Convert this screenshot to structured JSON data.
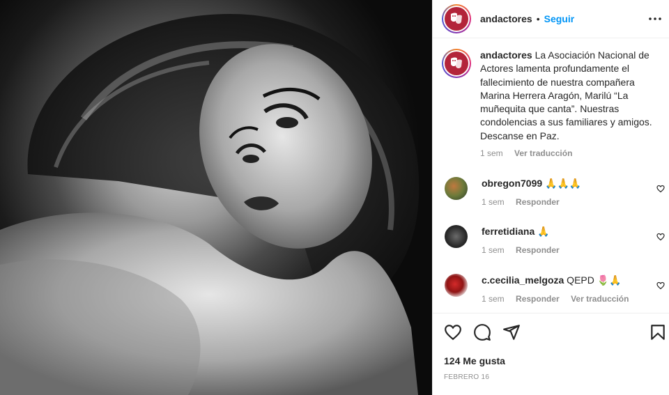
{
  "post": {
    "username": "andactores",
    "follow_label": "Seguir",
    "separator": "•",
    "caption_user": "andactores",
    "caption_text": " La Asociación Nacional de Actores lamenta profundamente el fallecimiento de nuestra compañera Marina Herrera Aragón, Marilú “La muñequita que canta”. Nuestras condolencias a sus familiares y amigos. Descanse en Paz.",
    "caption_time": "1 sem",
    "caption_translate": "Ver traducción",
    "likes": "124 Me gusta",
    "date": "FEBRERO 16"
  },
  "comments": [
    {
      "user": "obregon7099",
      "text": " 🙏🙏🙏",
      "time": "1 sem",
      "reply": "Responder",
      "translate": ""
    },
    {
      "user": "ferretidiana",
      "text": " 🙏",
      "time": "1 sem",
      "reply": "Responder",
      "translate": ""
    },
    {
      "user": "c.cecilia_melgoza",
      "text": " QEPD 🌷🙏",
      "time": "1 sem",
      "reply": "Responder",
      "translate": "Ver traducción"
    }
  ],
  "icons": {
    "more": "more-horizontal-icon",
    "like": "heart-icon",
    "comment": "comment-icon",
    "share": "share-icon",
    "save": "bookmark-icon"
  },
  "colors": {
    "accent": "#0095f6",
    "brand": "#b3243a",
    "muted": "#8e8e8e"
  }
}
